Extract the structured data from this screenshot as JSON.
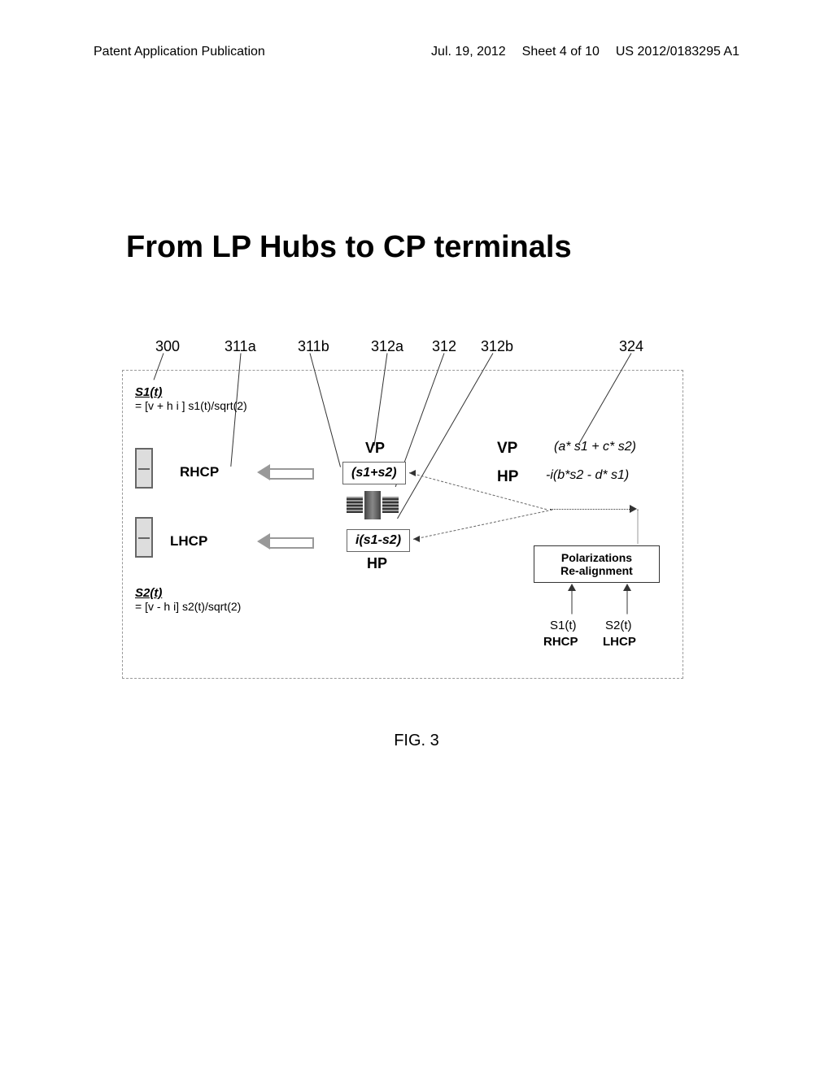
{
  "header": {
    "left": "Patent Application Publication",
    "date": "Jul. 19, 2012",
    "sheet": "Sheet 4 of 10",
    "pubnum": "US 2012/0183295 A1"
  },
  "title": "From LP Hubs to CP terminals",
  "refs": {
    "r300": "300",
    "r311a": "311a",
    "r311b": "311b",
    "r312a": "312a",
    "r312": "312",
    "r312b": "312b",
    "r324": "324"
  },
  "signals": {
    "s1_label": "S1(t)",
    "s1_formula": "= [v + h i ] s1(t)/sqrt(2)",
    "s2_label": "S2(t)",
    "s2_formula": "= [v - h i] s2(t)/sqrt(2)"
  },
  "polarization": {
    "rhcp": "RHCP",
    "lhcp": "LHCP",
    "vp": "VP",
    "hp": "HP"
  },
  "sums": {
    "sum1": "(s1+s2)",
    "sum2": "i(s1-s2)"
  },
  "right_formulas": {
    "f1": "(a* s1 + c* s2)",
    "f2": "-i(b*s2 - d* s1)"
  },
  "realign": {
    "line1": "Polarizations",
    "line2": "Re-alignment"
  },
  "bottom": {
    "s1": "S1(t)",
    "s2": "S2(t)",
    "rhcp": "RHCP",
    "lhcp": "LHCP"
  },
  "figure_label": "FIG. 3"
}
